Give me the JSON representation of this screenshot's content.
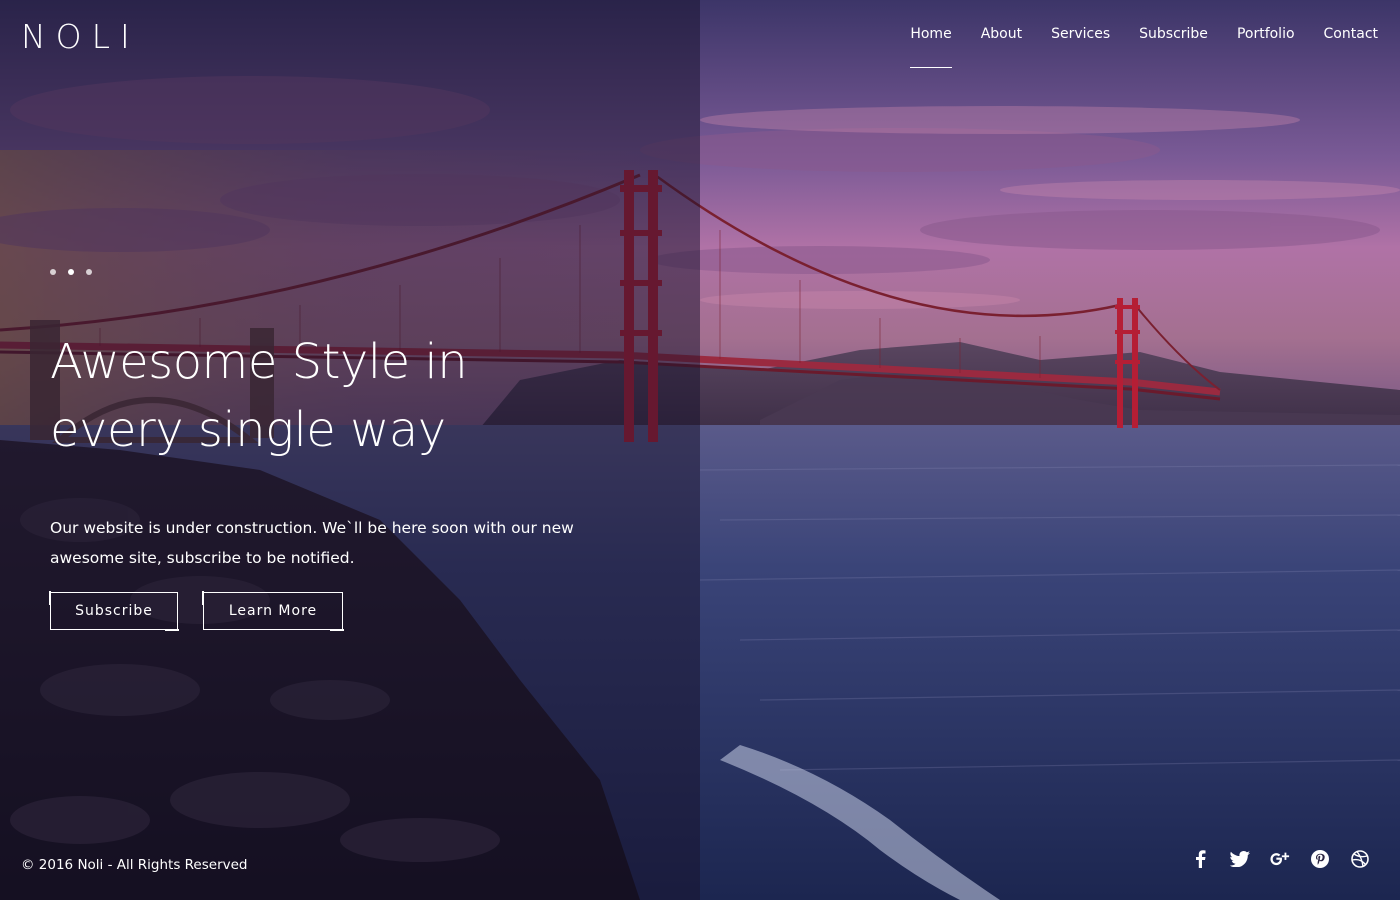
{
  "brand": {
    "logo_text": "NOLI"
  },
  "nav": {
    "items": [
      {
        "label": "Home",
        "active": true
      },
      {
        "label": "About",
        "active": false
      },
      {
        "label": "Services",
        "active": false
      },
      {
        "label": "Subscribe",
        "active": false
      },
      {
        "label": "Portfolio",
        "active": false
      },
      {
        "label": "Contact",
        "active": false
      }
    ]
  },
  "slider": {
    "dot_count": 3,
    "active_index": 1
  },
  "hero": {
    "headline_line1": "Awesome Style in",
    "headline_line2": "every single way",
    "intro_line1": "Our website is under construction. We`ll be here soon with our new",
    "intro_line2": "awesome site, subscribe to be notified.",
    "subscribe_label": "Subscribe",
    "learn_more_label": "Learn More"
  },
  "footer": {
    "copyright": "© 2016 Noli - All Rights Reserved"
  },
  "social": {
    "icons": [
      "facebook-icon",
      "twitter-icon",
      "google-plus-icon",
      "pinterest-icon",
      "dribbble-icon"
    ]
  },
  "colors": {
    "overlay_dark": "#18122c",
    "sky_top": "#5a4a86",
    "sky_pink": "#b86fa5",
    "water": "#2b3a6b",
    "bridge_red": "#b51e35"
  }
}
